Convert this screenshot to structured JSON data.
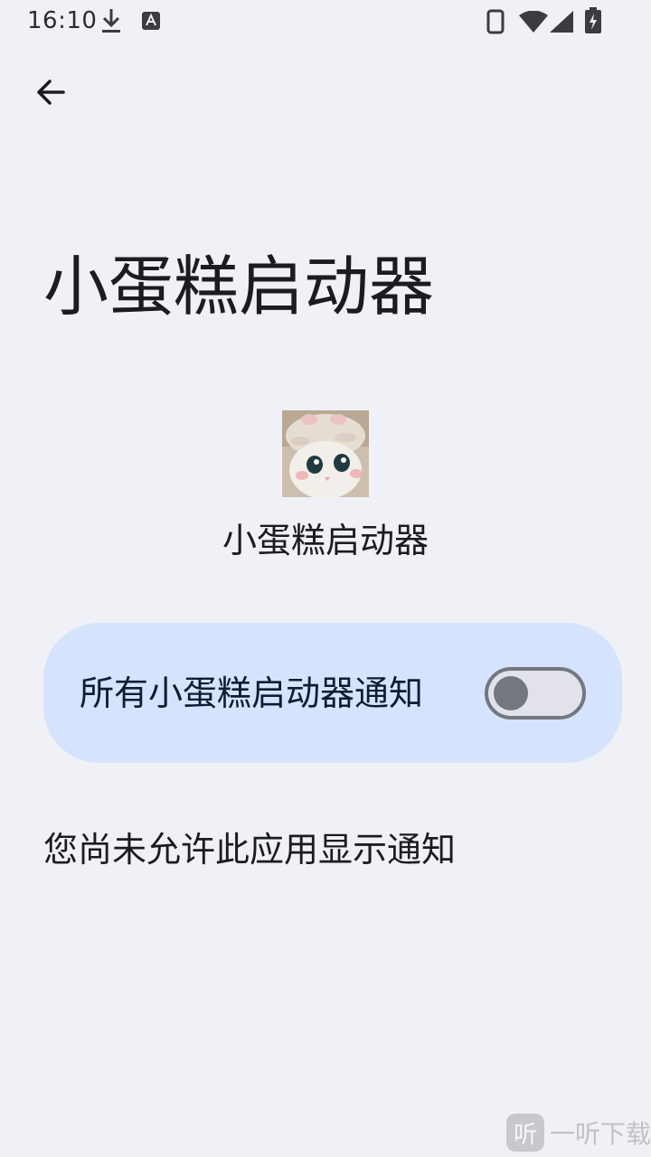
{
  "status_bar": {
    "time": "16:10",
    "icons": [
      "download-icon",
      "a-icon",
      "phone-icon",
      "wifi-icon",
      "signal-icon",
      "battery-charging-icon"
    ]
  },
  "header": {
    "back_icon": "arrow-back-icon",
    "title": "小蛋糕启动器"
  },
  "app": {
    "name": "小蛋糕启动器",
    "icon": "cat-photo-icon"
  },
  "notification_setting": {
    "label": "所有小蛋糕启动器通知",
    "enabled": false
  },
  "footer": {
    "message": "您尚未允许此应用显示通知"
  },
  "watermark": {
    "logo_glyph": "听",
    "text": "一听下载"
  },
  "colors": {
    "background": "#EFF1F7",
    "card": "#D6E3FC",
    "toggle_outline": "#74777F"
  }
}
